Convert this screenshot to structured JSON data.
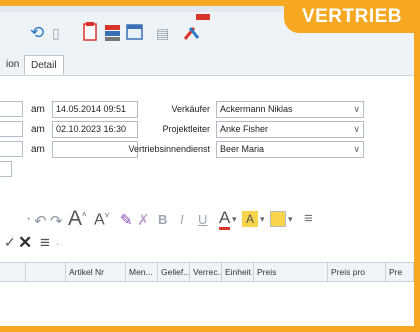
{
  "badge": "VERTRIEB",
  "tabs": [
    "ion",
    "Detail"
  ],
  "rows": [
    {
      "am": "am",
      "date": "14.05.2014 09:51",
      "label": "Verkäufer",
      "value": "Ackermann Niklas"
    },
    {
      "am": "am",
      "date": "02.10.2023 16:30",
      "label": "Projektleiter",
      "value": "Anke Fisher"
    },
    {
      "am": "am",
      "date": "",
      "label": "Vertriebsinnendienst",
      "value": "Beer Maria"
    }
  ],
  "table_headers": [
    "Artikel Nr",
    "Men...",
    "Gelief...",
    "Verrec...",
    "Einheit",
    "Preis",
    "Preis pro",
    "Pre"
  ],
  "icons": {
    "sync": "sync-icon",
    "doc": "document-icon",
    "calendar": "calendar-icon",
    "stack": "stack-icon",
    "window": "window-icon",
    "list": "list-icon",
    "tools": "tools-icon"
  },
  "colors": {
    "accent": "#f7a823",
    "toolbar_bg": "#eef3f8"
  }
}
